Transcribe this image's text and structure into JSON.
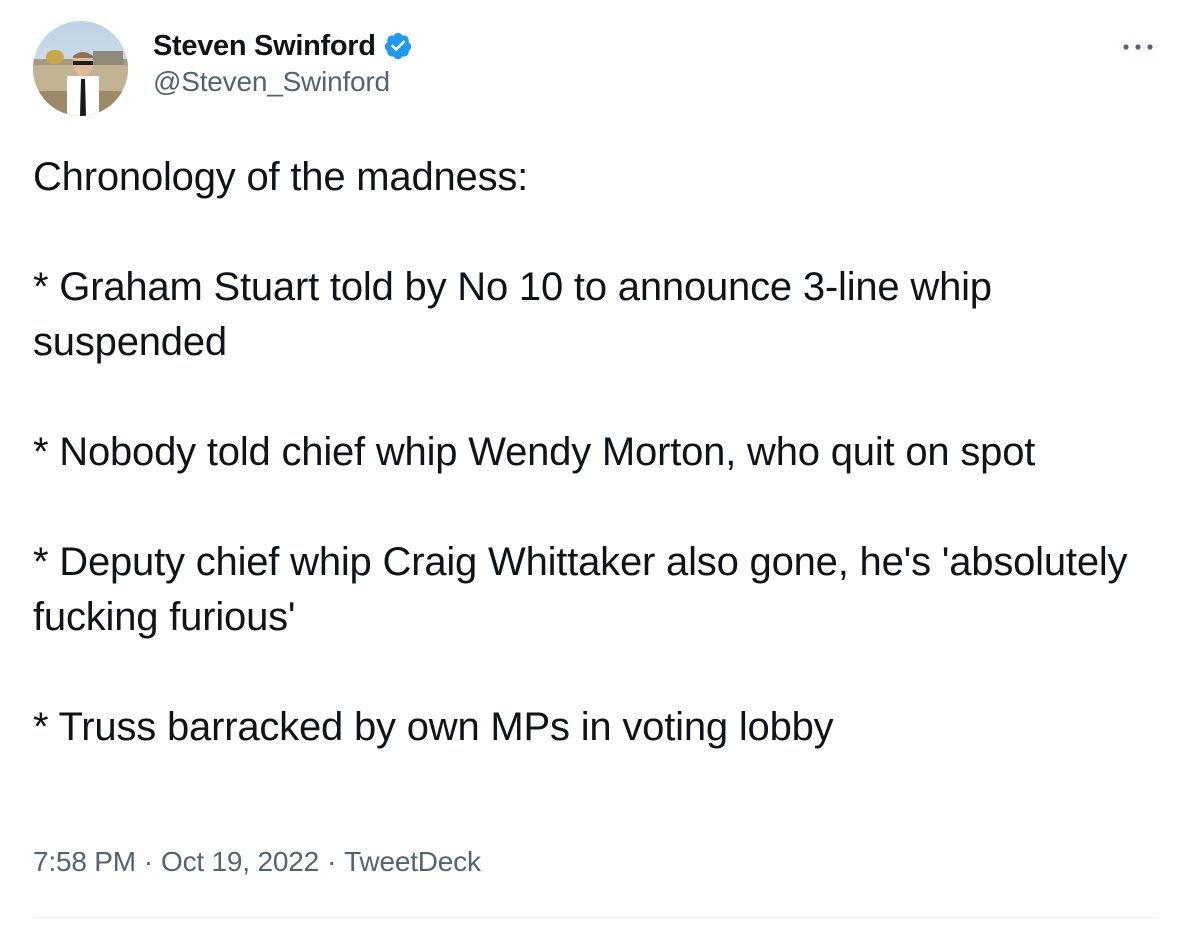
{
  "tweet": {
    "author": {
      "display_name": "Steven Swinford",
      "handle": "@Steven_Swinford",
      "verified": true
    },
    "text_paragraphs": [
      "Chronology of the madness:",
      "* Graham Stuart told by No 10 to announce 3-line whip suspended",
      "* Nobody told chief whip Wendy Morton, who quit on spot",
      "* Deputy chief whip Craig Whittaker also gone, he's 'absolutely fucking furious'",
      "* Truss barracked by own MPs in voting lobby"
    ],
    "time": "7:58 PM",
    "date": "Oct 19, 2022",
    "source": "TweetDeck",
    "separator": "·"
  },
  "icons": {
    "avatar": "avatar",
    "verified": "verified-badge-icon",
    "more": "more-options-icon"
  },
  "colors": {
    "text_primary": "#0f1419",
    "text_secondary": "#536471",
    "verified_blue": "#1d9bf0",
    "divider": "#eff3f4"
  }
}
